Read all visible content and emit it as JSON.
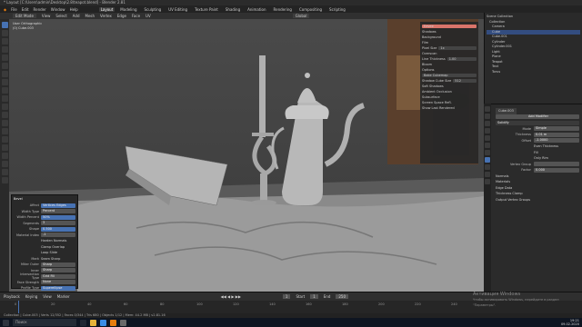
{
  "window": {
    "title": "* Layout [C:\\Users\\admin\\Desktop\\2.8\\teapot.blend] - Blender 2.81"
  },
  "menubar": {
    "items": [
      "File",
      "Edit",
      "Render",
      "Window",
      "Help"
    ],
    "workspaces": [
      "Layout",
      "Modeling",
      "Sculpting",
      "UV Editing",
      "Texture Paint",
      "Shading",
      "Animation",
      "Rendering",
      "Compositing",
      "Scripting"
    ],
    "active_workspace": "Layout"
  },
  "viewport_header": {
    "mode": "Edit Mode",
    "menus": [
      "View",
      "Select",
      "Add",
      "Mesh",
      "Vertex",
      "Edge",
      "Face",
      "UV"
    ],
    "orientation": "Global",
    "view_label": "User Orthographic",
    "object_label": "(0) Cube.003"
  },
  "operator_panel": {
    "title": "Bevel",
    "rows": [
      {
        "label": "Affect",
        "value": "Vertices  Edges"
      },
      {
        "label": "Width Type",
        "value": "Percent"
      },
      {
        "label": "Width Percent",
        "value": "50%"
      },
      {
        "label": "Segments",
        "value": "3"
      },
      {
        "label": "Shape",
        "value": "0.500"
      },
      {
        "label": "Material Index",
        "value": "-1"
      },
      {
        "label": "",
        "value": "Harden Normals"
      },
      {
        "label": "",
        "value": "Clamp Overlap"
      },
      {
        "label": "",
        "value": "Loop Slide"
      },
      {
        "label": "Mark",
        "value": "Seam  Sharp"
      },
      {
        "label": "Miter Outer",
        "value": "Sharp"
      },
      {
        "label": "Inner",
        "value": "Sharp"
      },
      {
        "label": "Intersection Type",
        "value": "Grid Fill"
      },
      {
        "label": "Face Strength",
        "value": "None"
      },
      {
        "label": "Profile Type",
        "value": "Superellipse"
      }
    ]
  },
  "n_panel": {
    "rows": [
      {
        "label": "Eevee",
        "value": ""
      },
      {
        "label": "Shadows",
        "value": ""
      },
      {
        "label": "Background",
        "value": ""
      },
      {
        "label": "Film",
        "value": ""
      },
      {
        "label": "Pixel Size",
        "value": "1x"
      },
      {
        "label": "Overscan",
        "value": ""
      },
      {
        "label": "Line Thickness",
        "value": "1.00"
      },
      {
        "label": "Bloom",
        "value": ""
      },
      {
        "label": "Options",
        "value": ""
      },
      {
        "label": "Bake Cubemap",
        "value": ""
      },
      {
        "label": "Shadow Cube Size",
        "value": "512"
      },
      {
        "label": "Soft Shadows",
        "value": ""
      },
      {
        "label": "Ambient Occlusion",
        "value": ""
      },
      {
        "label": "Subsurface",
        "value": ""
      },
      {
        "label": "Screen Space Refl.",
        "value": ""
      },
      {
        "label": "Show Last Rendered",
        "value": ""
      }
    ]
  },
  "outliner": {
    "items": [
      {
        "label": "Scene Collection",
        "selected": false
      },
      {
        "label": "Collection",
        "selected": false
      },
      {
        "label": "Camera",
        "selected": false
      },
      {
        "label": "Cube",
        "selected": true
      },
      {
        "label": "Cube.001",
        "selected": false
      },
      {
        "label": "Cylinder",
        "selected": false
      },
      {
        "label": "Cylinder.001",
        "selected": false
      },
      {
        "label": "Light",
        "selected": false
      },
      {
        "label": "Plane",
        "selected": false
      },
      {
        "label": "Teapot",
        "selected": false
      },
      {
        "label": "Text",
        "selected": false
      },
      {
        "label": "Torus",
        "selected": false
      }
    ]
  },
  "properties": {
    "object_name": "Cube.003",
    "modifier_button": "Add Modifier",
    "modifier_name": "Solidify",
    "rows": [
      {
        "label": "Mode",
        "value": "Simple"
      },
      {
        "label": "Thickness",
        "value": "0.01 m"
      },
      {
        "label": "Offset",
        "value": "-1.0000"
      },
      {
        "label": "",
        "value": "Even Thickness"
      },
      {
        "label": "",
        "value": "Fill"
      },
      {
        "label": "",
        "value": "Only Rim"
      },
      {
        "label": "Vertex Group",
        "value": ""
      },
      {
        "label": "Factor",
        "value": "0.000"
      }
    ],
    "sections": [
      "Normals",
      "Materials",
      "Edge Data",
      "Thickness Clamp",
      "Output Vertex Groups"
    ]
  },
  "timeline": {
    "menus": [
      "Playback",
      "Keying",
      "View",
      "Marker"
    ],
    "current_frame": "1",
    "start_label": "Start",
    "start": "1",
    "end_label": "End",
    "end": "250",
    "ticks": [
      "0",
      "20",
      "40",
      "60",
      "80",
      "100",
      "120",
      "140",
      "160",
      "180",
      "200",
      "220",
      "240"
    ]
  },
  "statusbar": {
    "text": "Collection | Cube.003 | Verts 12/352 | Faces 0/344 | Tris 680 | Objects 1/12 | Mem: 44.2 MB | v2.81.16"
  },
  "watermark": {
    "line1": "Активация Windows",
    "line2": "Чтобы активировать Windows, перейдите в раздел \"Параметры\"."
  },
  "taskbar": {
    "search_placeholder": "Поиск",
    "time": "19:21",
    "date": "09.02.2020"
  },
  "colors": {
    "accent": "#4772b3",
    "selected": "#334d80",
    "field": "#545454",
    "warning_field": "#d9746a"
  }
}
